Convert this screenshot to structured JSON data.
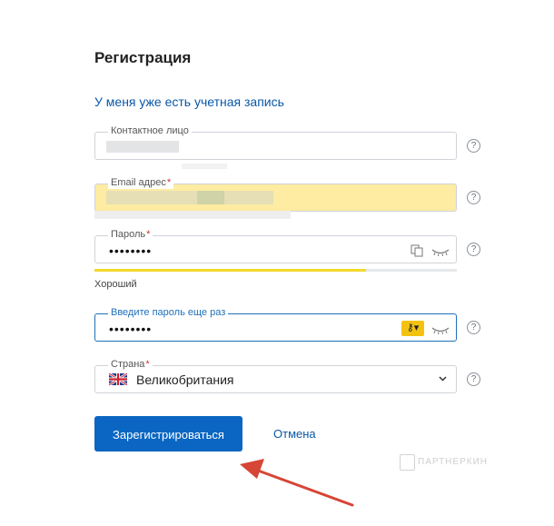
{
  "form": {
    "title": "Регистрация",
    "login_link": "У меня уже есть учетная запись",
    "contact": {
      "label": "Контактное лицо"
    },
    "email": {
      "label": "Email адрес",
      "required_mark": "*"
    },
    "password": {
      "label": "Пароль",
      "required_mark": "*",
      "value": "••••••••"
    },
    "password_strength": {
      "label": "Хороший",
      "level": 0.75,
      "color": "#f3d92a"
    },
    "confirm_password": {
      "label": "Введите пароль еще раз",
      "value": "••••••••"
    },
    "country": {
      "label": "Страна",
      "required_mark": "*",
      "value": "Великобритания",
      "flag": "uk-flag-icon"
    },
    "help_icon": "?",
    "submit_label": "Зарегистрироваться",
    "cancel_label": "Отмена"
  },
  "watermark": {
    "text": "ПАРТНЕРКИН"
  },
  "colors": {
    "primary": "#0a66c2",
    "link": "#0a57a8",
    "autofill": "#fdeca1",
    "strength": "#f3d92a",
    "arrow": "#d64535"
  }
}
